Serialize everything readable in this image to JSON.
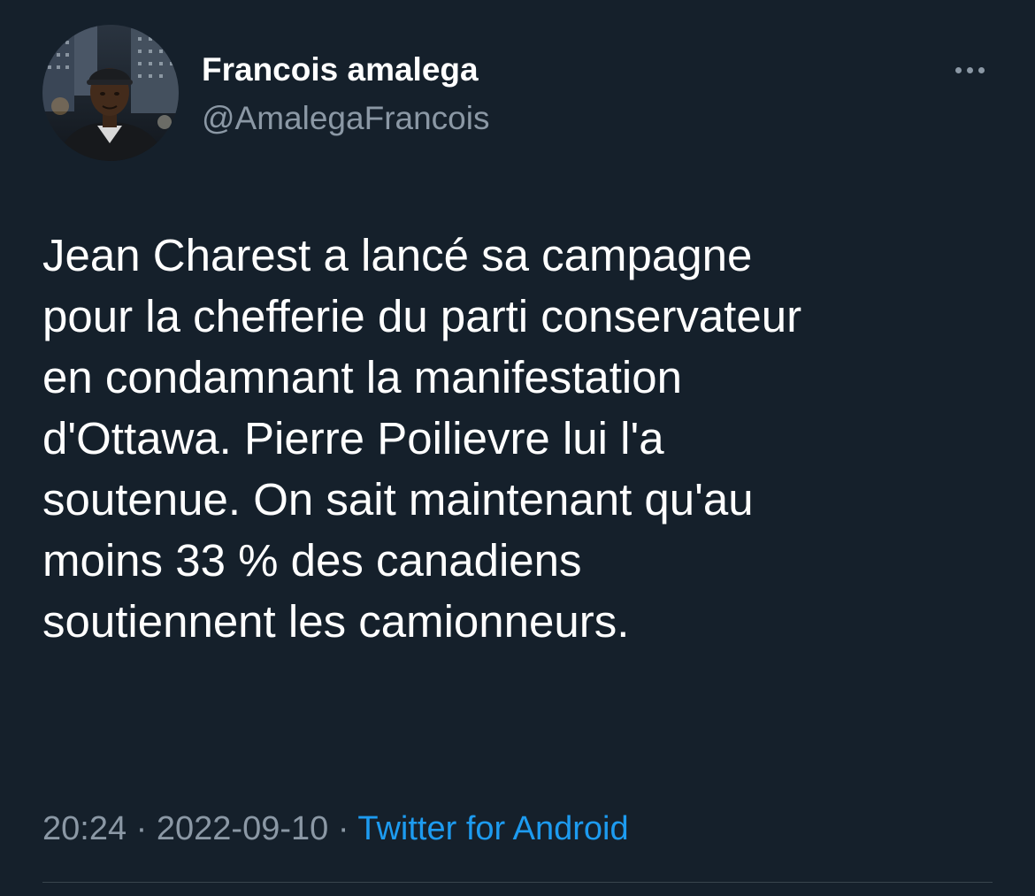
{
  "tweet": {
    "author": {
      "display_name": "Francois amalega",
      "handle": "@AmalegaFrancois",
      "avatar_icon": "profile-photo"
    },
    "more_icon": "more-horizontal-icon",
    "text": "Jean Charest a lancé sa campagne\npour la chefferie du parti conservateur\nen condamnant la manifestation\nd'Ottawa. Pierre Poilievre lui l'a\nsoutenue. On sait maintenant qu'au\nmoins 33 % des canadiens\nsoutiennent les camionneurs.",
    "time": "20:24",
    "date": "2022-09-10",
    "separator": "·",
    "source": "Twitter for Android"
  },
  "colors": {
    "background": "#15202b",
    "primary_text": "#ffffff",
    "secondary_text": "#8b98a5",
    "link": "#1d9bf0",
    "divider": "#38444d"
  }
}
